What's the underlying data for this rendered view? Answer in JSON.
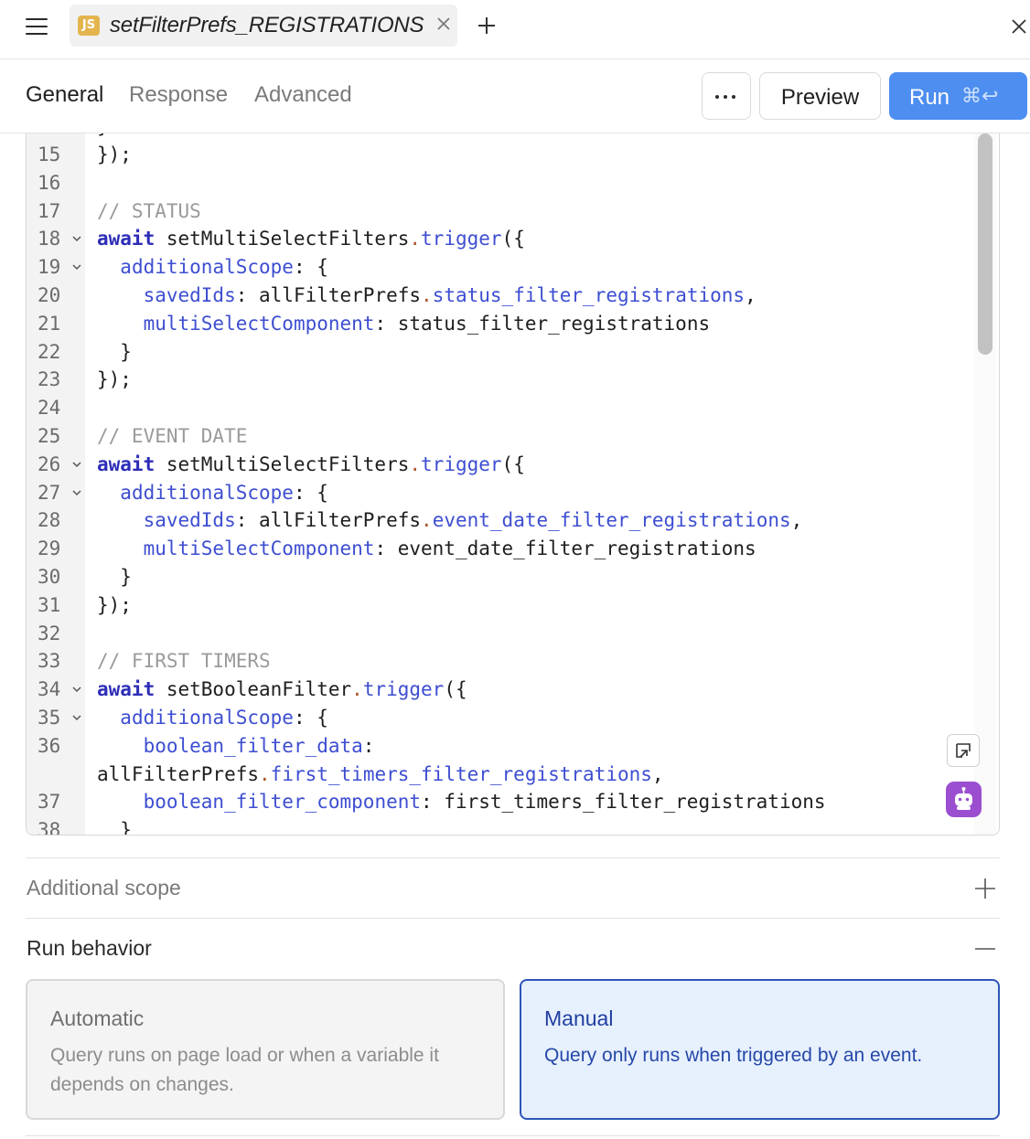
{
  "tab": {
    "badge": "JS",
    "title": "setFilterPrefs_REGISTRATIONS"
  },
  "toolbar": {
    "tabs": [
      "General",
      "Response",
      "Advanced"
    ],
    "active_tab": "General",
    "more_label": "⋯",
    "preview_label": "Preview",
    "run_label": "Run",
    "run_shortcut": "⌘↩"
  },
  "editor": {
    "lines": [
      {
        "n": "15",
        "fold": false,
        "html": "});"
      },
      {
        "n": "16",
        "fold": false,
        "html": ""
      },
      {
        "n": "17",
        "fold": false,
        "html": "<span class='cm'>// STATUS</span>"
      },
      {
        "n": "18",
        "fold": true,
        "html": "<span class='kw'>await</span> setMultiSelectFilters<span class='dot'>.</span><span class='prop'>trigger</span>({"
      },
      {
        "n": "19",
        "fold": true,
        "html": "  <span class='prop'>additionalScope</span>: {"
      },
      {
        "n": "20",
        "fold": false,
        "html": "    <span class='prop'>savedIds</span>: allFilterPrefs<span class='dot'>.</span><span class='prop'>status_filter_registrations</span>,"
      },
      {
        "n": "21",
        "fold": false,
        "html": "    <span class='prop'>multiSelectComponent</span>: status_filter_registrations"
      },
      {
        "n": "22",
        "fold": false,
        "html": "  }"
      },
      {
        "n": "23",
        "fold": false,
        "html": "});"
      },
      {
        "n": "24",
        "fold": false,
        "html": ""
      },
      {
        "n": "25",
        "fold": false,
        "html": "<span class='cm'>// EVENT DATE</span>"
      },
      {
        "n": "26",
        "fold": true,
        "html": "<span class='kw'>await</span> setMultiSelectFilters<span class='dot'>.</span><span class='prop'>trigger</span>({"
      },
      {
        "n": "27",
        "fold": true,
        "html": "  <span class='prop'>additionalScope</span>: {"
      },
      {
        "n": "28",
        "fold": false,
        "html": "    <span class='prop'>savedIds</span>: allFilterPrefs<span class='dot'>.</span><span class='prop'>event_date_filter_registrations</span>,"
      },
      {
        "n": "29",
        "fold": false,
        "html": "    <span class='prop'>multiSelectComponent</span>: event_date_filter_registrations"
      },
      {
        "n": "30",
        "fold": false,
        "html": "  }"
      },
      {
        "n": "31",
        "fold": false,
        "html": "});"
      },
      {
        "n": "32",
        "fold": false,
        "html": ""
      },
      {
        "n": "33",
        "fold": false,
        "html": "<span class='cm'>// FIRST TIMERS</span>"
      },
      {
        "n": "34",
        "fold": true,
        "html": "<span class='kw'>await</span> setBooleanFilter<span class='dot'>.</span><span class='prop'>trigger</span>({"
      },
      {
        "n": "35",
        "fold": true,
        "html": "  <span class='prop'>additionalScope</span>: {"
      },
      {
        "n": "36",
        "fold": false,
        "html": "    <span class='prop'>boolean_filter_data</span>:"
      },
      {
        "n": "",
        "fold": false,
        "html": "allFilterPrefs<span class='dot'>.</span><span class='prop'>first_timers_filter_registrations</span>,"
      },
      {
        "n": "37",
        "fold": false,
        "html": "    <span class='prop'>boolean_filter_component</span>: first_timers_filter_registrations"
      },
      {
        "n": "38",
        "fold": false,
        "html": "  }"
      }
    ]
  },
  "additional_scope": {
    "title": "Additional scope"
  },
  "run_behavior": {
    "title": "Run behavior",
    "automatic": {
      "title": "Automatic",
      "desc": "Query runs on page load or when a variable it depends on changes."
    },
    "manual": {
      "title": "Manual",
      "desc": "Query only runs when triggered by an event."
    },
    "selected": "Manual"
  }
}
